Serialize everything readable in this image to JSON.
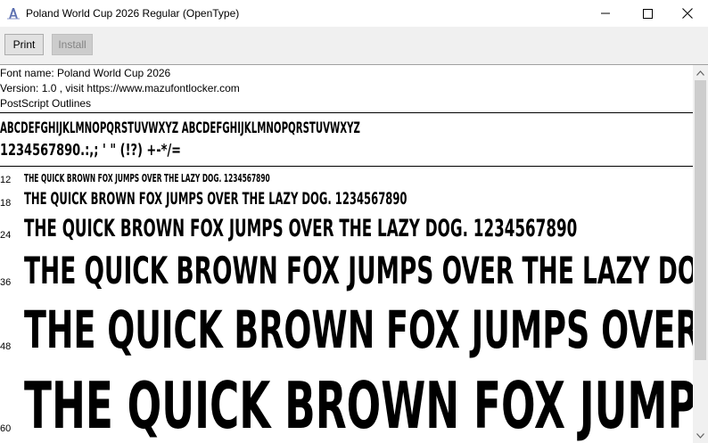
{
  "window": {
    "title": "Poland World Cup 2026 Regular (OpenType)"
  },
  "toolbar": {
    "print_label": "Print",
    "install_label": "Install"
  },
  "info": {
    "font_name": "Font name: Poland World Cup 2026",
    "version": "Version: 1.0 , visit https://www.mazufontlocker.com",
    "outline": "PostScript Outlines"
  },
  "charset": {
    "line1": "ABCDEFGHIJKLMNOPQRSTUVWXYZ ABCDEFGHIJKLMNOPQRSTUVWXYZ",
    "line2": "1234567890.:,; ' \" (!?) +-*/="
  },
  "samples": [
    {
      "size": "12",
      "text": "THE QUICK BROWN FOX JUMPS OVER THE LAZY DOG. 1234567890"
    },
    {
      "size": "18",
      "text": "THE QUICK BROWN FOX JUMPS OVER THE LAZY DOG. 1234567890"
    },
    {
      "size": "24",
      "text": "THE QUICK BROWN FOX JUMPS OVER THE LAZY DOG. 1234567890"
    },
    {
      "size": "36",
      "text": "THE QUICK BROWN FOX JUMPS OVER THE LAZY DOG"
    },
    {
      "size": "48",
      "text": "THE QUICK BROWN FOX JUMPS OVER T"
    },
    {
      "size": "60",
      "text": "THE QUICK BROWN FOX JUMPS"
    }
  ],
  "icons": {
    "app": "font-viewer-icon",
    "minimize": "minimize-icon",
    "maximize": "maximize-icon",
    "close": "close-icon",
    "scroll_up": "scroll-up-arrow-icon",
    "scroll_down": "scroll-down-arrow-icon"
  }
}
